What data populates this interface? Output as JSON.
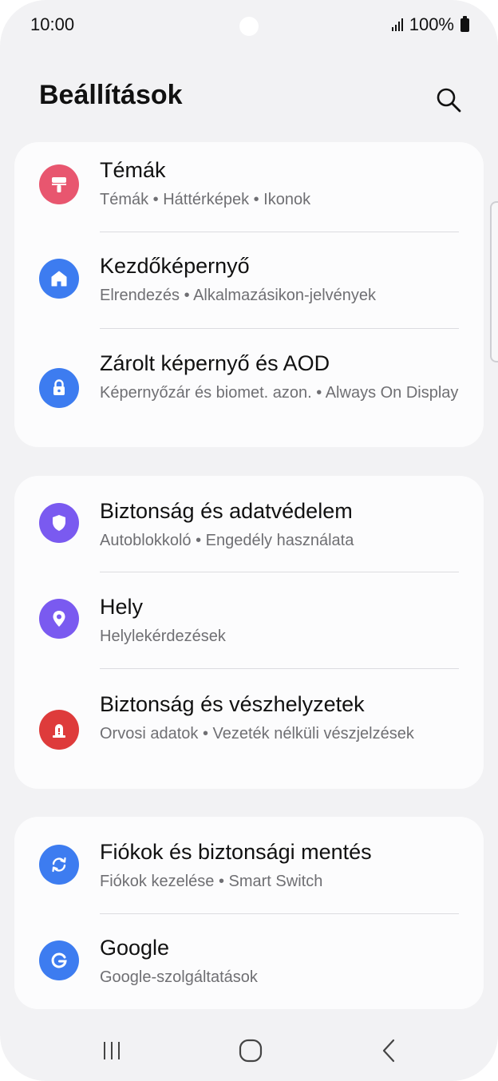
{
  "status_bar": {
    "time": "10:00",
    "battery_text": "100%",
    "icons": [
      "signal-icon",
      "battery-icon"
    ]
  },
  "header": {
    "title": "Beállítások",
    "search_icon": "search-icon"
  },
  "groups": [
    {
      "items": [
        {
          "title": "Témák",
          "subtitle": "Témák • Háttérképek • Ikonok",
          "icon": "themes-icon",
          "color": "#e8566f"
        },
        {
          "title": "Kezdőképernyő",
          "subtitle": "Elrendezés • Alkalmazásikon-jelvények",
          "icon": "home-icon",
          "color": "#3d7cf0"
        },
        {
          "title": "Zárolt képernyő és AOD",
          "subtitle": "Képernyőzár és biomet. azon. • Always On Display",
          "icon": "lock-icon",
          "color": "#3d7cf0"
        }
      ]
    },
    {
      "items": [
        {
          "title": "Biztonság és adatvédelem",
          "subtitle": "Autoblokkoló • Engedély használata",
          "icon": "shield-icon",
          "color": "#7a5af0"
        },
        {
          "title": "Hely",
          "subtitle": "Helylekérdezések",
          "icon": "location-icon",
          "color": "#7a5af0"
        },
        {
          "title": "Biztonság és vészhelyzetek",
          "subtitle": "Orvosi adatok • Vezeték nélküli vészjelzések",
          "icon": "emergency-icon",
          "color": "#de3b3b"
        }
      ]
    },
    {
      "items": [
        {
          "title": "Fiókok és biztonsági mentés",
          "subtitle": "Fiókok kezelése • Smart Switch",
          "icon": "sync-icon",
          "color": "#3d7cf0"
        },
        {
          "title": "Google",
          "subtitle": "Google-szolgáltatások",
          "icon": "google-icon",
          "color": "#3d7cf0"
        }
      ]
    }
  ],
  "nav_bar": {
    "icons": [
      "recents-icon",
      "home-button-icon",
      "back-icon"
    ]
  }
}
